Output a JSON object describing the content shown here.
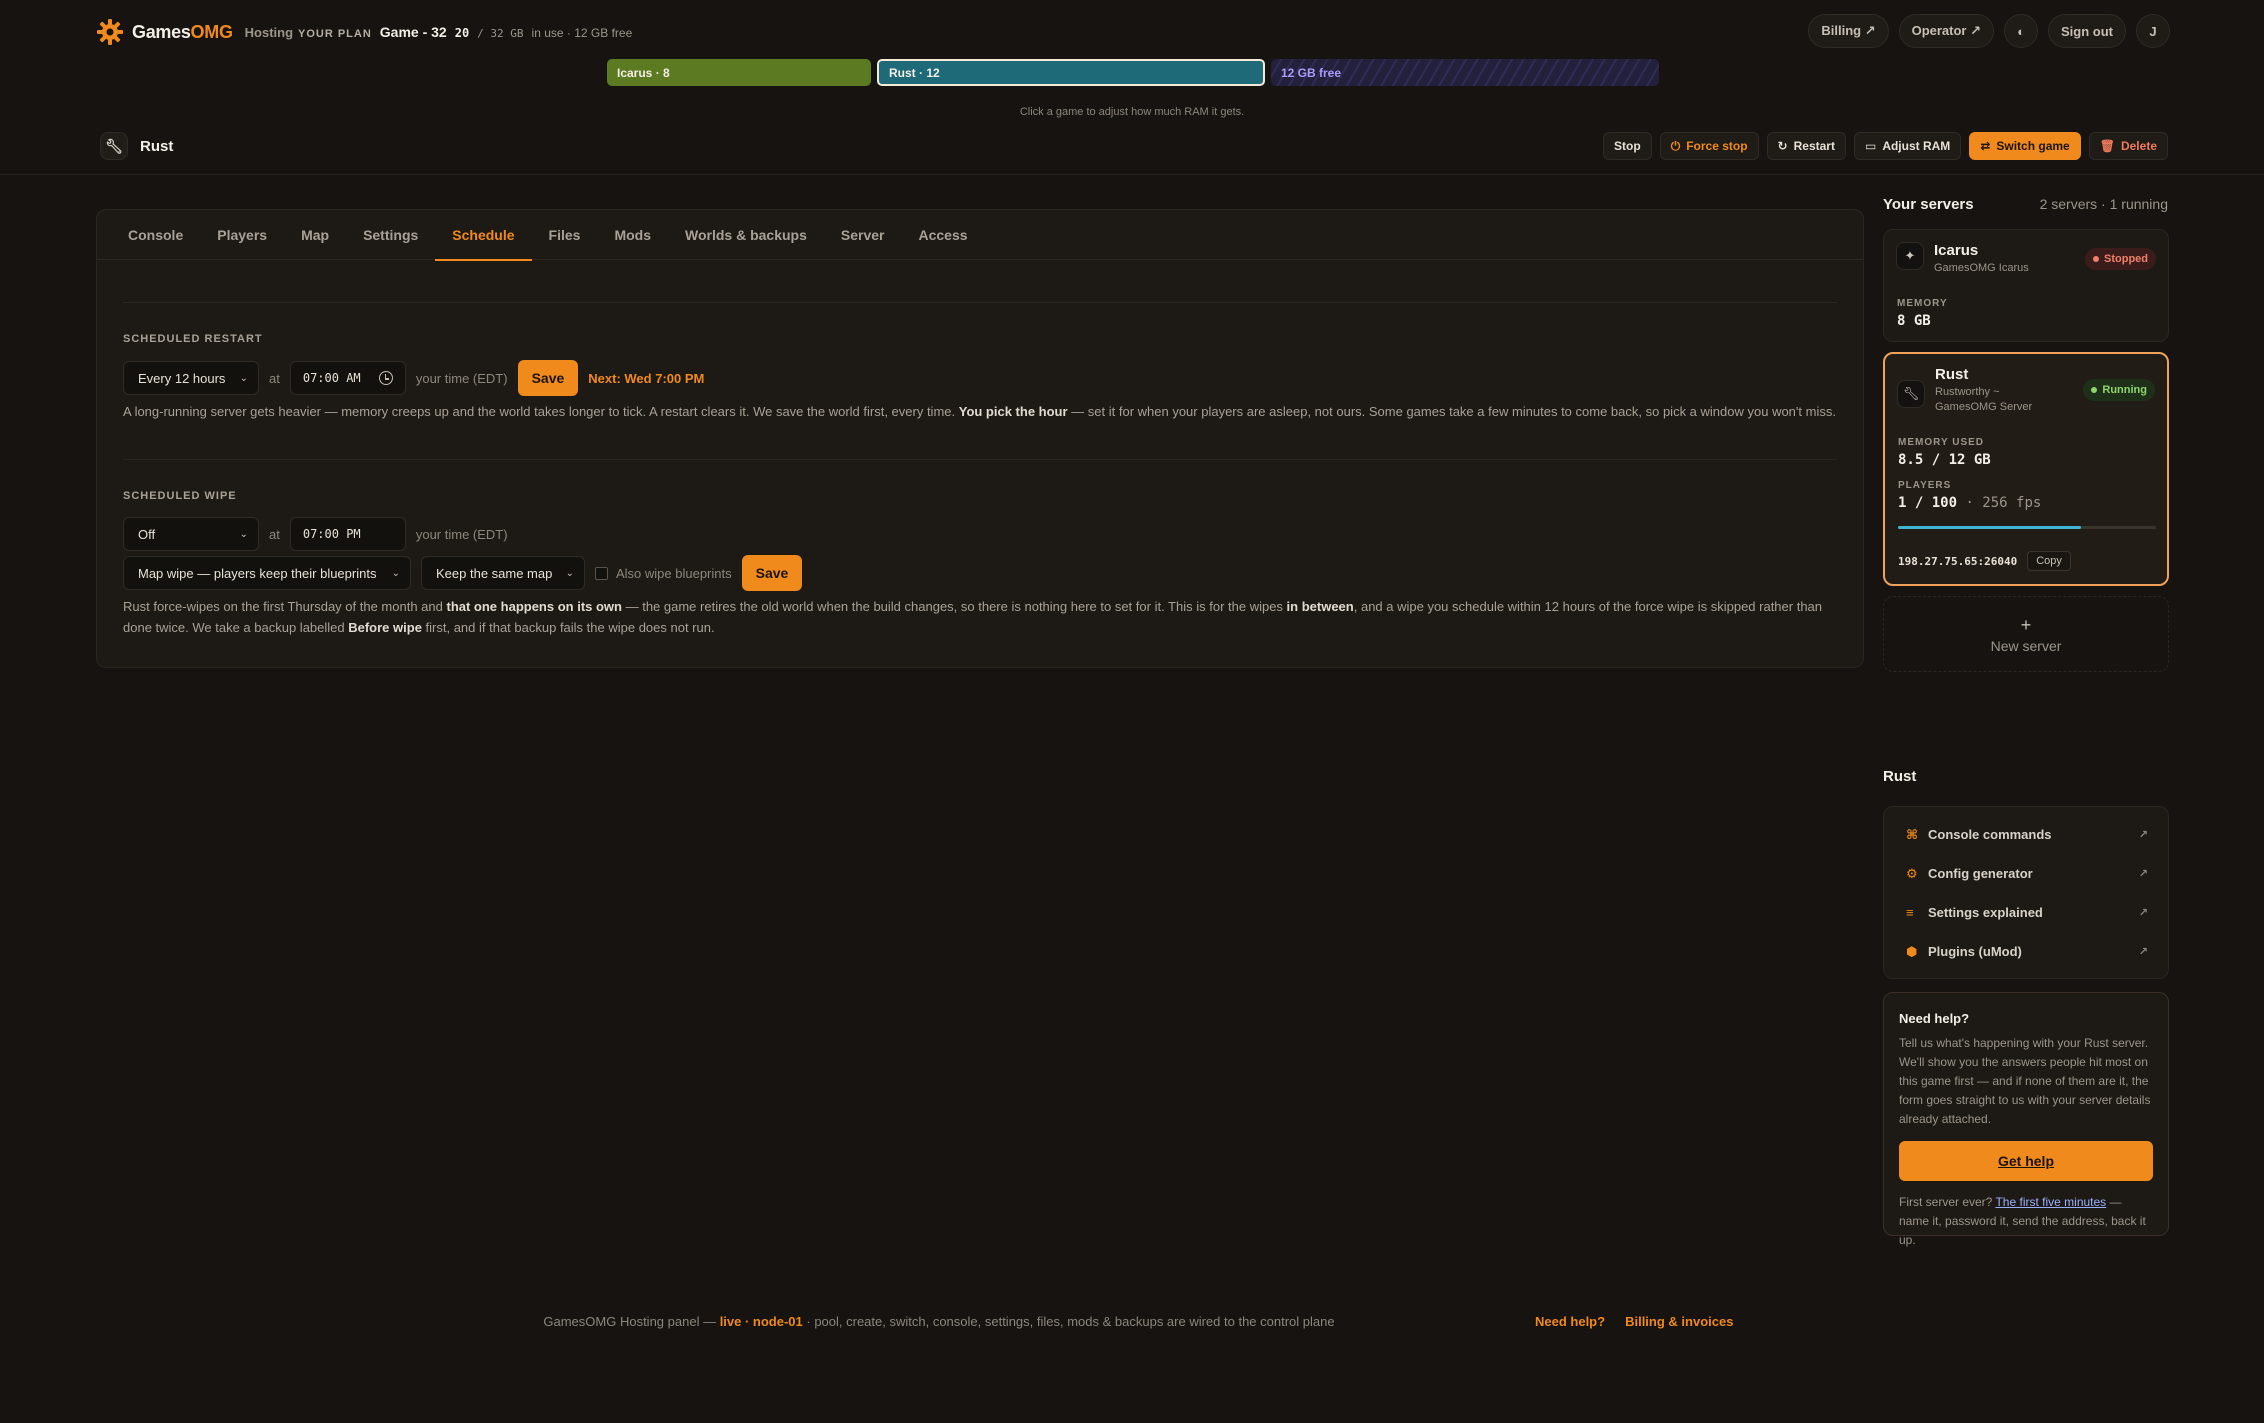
{
  "header": {
    "brand_main": "Games",
    "brand_omg": "OMG",
    "brand_sub": "Hosting",
    "plan_label": "YOUR PLAN",
    "plan_name": "Game - 32",
    "plan_used": "20",
    "plan_total": "/ 32 GB",
    "plan_note": "in use · 12 GB free",
    "billing": "Billing ↗",
    "operator": "Operator ↗",
    "theme_icon": "◐",
    "sign_out": "Sign out",
    "avatar": "J"
  },
  "ram": {
    "icarus": "Icarus · 8",
    "rust": "Rust · 12",
    "free": "12 GB free",
    "hint": "Click a game to adjust how much RAM it gets."
  },
  "server": {
    "name": "Rust",
    "actions": {
      "stop": "Stop",
      "force_stop": "Force stop",
      "restart": "Restart",
      "adjust_ram": "Adjust RAM",
      "switch_game": "Switch game",
      "delete": "Delete"
    }
  },
  "tabs": [
    "Console",
    "Players",
    "Map",
    "Settings",
    "Schedule",
    "Files",
    "Mods",
    "Worlds & backups",
    "Server",
    "Access"
  ],
  "active_tab": "Schedule",
  "restart": {
    "title": "SCHEDULED RESTART",
    "interval": "Every 12 hours",
    "at": "at",
    "time": "07:00 AM",
    "tz": "your time (EDT)",
    "save": "Save",
    "next": "Next: Wed 7:00 PM",
    "desc_1": "A long-running server gets heavier — memory creeps up and the world takes longer to tick. A restart clears it. We save the world first, every time. ",
    "desc_bold": "You pick the hour",
    "desc_2": " — set it for when your players are asleep, not ours. Some games take a few minutes to come back, so pick a window you won't miss."
  },
  "wipe": {
    "title": "SCHEDULED WIPE",
    "interval": "Off",
    "at": "at",
    "time": "07:00 PM",
    "tz": "your time (EDT)",
    "wipe_type": "Map wipe — players keep their blueprints",
    "map_choice": "Keep the same map",
    "also_bp": "Also wipe blueprints",
    "save": "Save",
    "desc_1": "Rust force-wipes on the first Thursday of the month and ",
    "desc_b1": "that one happens on its own",
    "desc_2": " — the game retires the old world when the build changes, so there is nothing here to set for it. This is for the wipes ",
    "desc_b2": "in between",
    "desc_3": ", and a wipe you schedule within 12 hours of the force wipe is skipped rather than done twice. We take a backup labelled ",
    "desc_b3": "Before wipe",
    "desc_4": " first, and if that backup fails the wipe does not run."
  },
  "sidebar": {
    "title": "Your servers",
    "summary": "2 servers · 1 running",
    "icarus": {
      "name": "Icarus",
      "host": "GamesOMG Icarus",
      "status": "Stopped",
      "mem_label": "MEMORY",
      "mem_value": "8 GB"
    },
    "rust": {
      "name": "Rust",
      "host_1": "Rustworthy ~",
      "host_2": "GamesOMG Server",
      "status": "Running",
      "mem_label": "MEMORY USED",
      "mem_value": "8.5 / 12 GB",
      "players_label": "PLAYERS",
      "players_value": "1 / 100",
      "fps": " · 256 fps",
      "player_fill": 0.71,
      "ip": "198.27.75.65:26040",
      "copy": "Copy"
    },
    "new_plus": "+",
    "new_label": "New server",
    "game_title": "Rust",
    "links": [
      {
        "icon": "⌘",
        "label": "Console commands",
        "ext": "↗"
      },
      {
        "icon": "⚙",
        "label": "Config generator",
        "ext": "↗"
      },
      {
        "icon": "≡",
        "label": "Settings explained",
        "ext": "↗"
      },
      {
        "icon": "⬢",
        "label": "Plugins (uMod)",
        "ext": "↗"
      }
    ],
    "help": {
      "title": "Need help?",
      "desc": "Tell us what's happening with your Rust server. We'll show you the answers people hit most on this game first — and if none of them are it, the form goes straight to us with your server details already attached.",
      "button": "Get help",
      "foot_1": "First server ever? ",
      "foot_link": "The first five minutes",
      "foot_2": " — name it, password it, send the address, back it up."
    }
  },
  "footer": {
    "text_1": "GamesOMG Hosting panel — ",
    "live": "live · node-01",
    "text_2": " · pool, create, switch, console, settings, files, mods & backups are wired to the control plane",
    "need_help": "Need help?",
    "billing": "Billing & invoices"
  }
}
